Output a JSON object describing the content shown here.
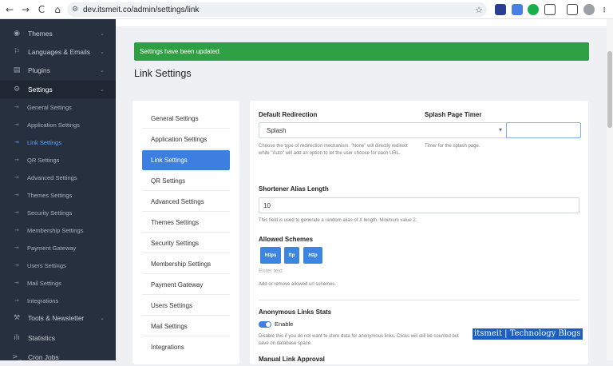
{
  "browser": {
    "back_icon": "←",
    "forward_icon": "→",
    "reload_icon": "C",
    "home_icon": "⌂",
    "tune_icon": "⚙",
    "url": "dev.itsmeit.co/admin/settings/link",
    "star_icon": "☆"
  },
  "sidebar": {
    "items": [
      {
        "label": "Themes",
        "icon": "◉",
        "chevron": "⌄"
      },
      {
        "label": "Languages & Emails",
        "icon": "⚐",
        "chevron": "⌄"
      },
      {
        "label": "Plugins",
        "icon": "▤",
        "chevron": "⌄"
      },
      {
        "label": "Settings",
        "icon": "⚙",
        "chevron": "⌄"
      }
    ],
    "sub_items": [
      {
        "label": "General Settings",
        "arrow": "→"
      },
      {
        "label": "Application Settings",
        "arrow": "→"
      },
      {
        "label": "Link Settings",
        "arrow": "→"
      },
      {
        "label": "QR Settings",
        "arrow": "→"
      },
      {
        "label": "Advanced Settings",
        "arrow": "→"
      },
      {
        "label": "Themes Settings",
        "arrow": "→"
      },
      {
        "label": "Security Settings",
        "arrow": "→"
      },
      {
        "label": "Membership Settings",
        "arrow": "→"
      },
      {
        "label": "Payment Gateway",
        "arrow": "→"
      },
      {
        "label": "Users Settings",
        "arrow": "→"
      },
      {
        "label": "Mail Settings",
        "arrow": "→"
      },
      {
        "label": "Integrations",
        "arrow": "→"
      }
    ],
    "bottom_items": [
      {
        "label": "Tools & Newsletter",
        "icon": "⚒",
        "chevron": "⌄"
      },
      {
        "label": "Statistics",
        "icon": "ılı"
      },
      {
        "label": "Cron Jobs",
        "icon": ">_"
      }
    ]
  },
  "alert": {
    "text": "Settings have been updated."
  },
  "page": {
    "title": "Link Settings"
  },
  "settings_menu": [
    "General Settings",
    "Application Settings",
    "Link Settings",
    "QR Settings",
    "Advanced Settings",
    "Themes Settings",
    "Security Settings",
    "Membership Settings",
    "Payment Gateway",
    "Users Settings",
    "Mail Settings",
    "Integrations"
  ],
  "form": {
    "default_redirection": {
      "label": "Default Redirection",
      "value": "Splash",
      "help": "Choose the type of redirection mechanism. \"None\" will directly redirect while \"Auto\" will add an option to let the user choose for each URL."
    },
    "splash_timer": {
      "label": "Splash Page Timer",
      "help": "Timer for the splash page."
    },
    "alias_length": {
      "label": "Shortener Alias Length",
      "value": "10",
      "help": "This field is used to generate a random alias of X length. Minimum value 2."
    },
    "allowed_schemes": {
      "label": "Allowed Schemes",
      "chips": [
        "https",
        "ftp",
        "http"
      ],
      "placeholder": "Enter text",
      "help": "Add or remove allowed url schemes."
    },
    "anonymous_stats": {
      "label": "Anonymous Links Stats",
      "toggle_label": "Enable",
      "help_line1": "Disable this if you do not want to store data for anonymous links. Clicks will still be counted but",
      "help_line2": "save on database space."
    },
    "manual_approval": {
      "label": "Manual Link Approval"
    }
  },
  "watermark": {
    "text": "itsmeit | Technology Blogs"
  }
}
